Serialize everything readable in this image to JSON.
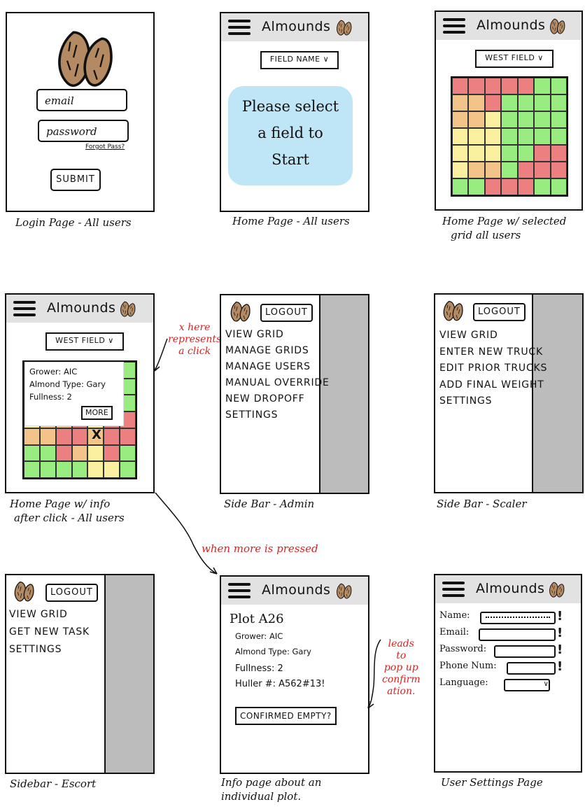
{
  "app_name": "Almounds",
  "colors": {
    "red": "#ec8080",
    "orange": "#f2c48a",
    "yellow": "#fbf0a0",
    "green": "#98ec80",
    "gray": "#bcbcbc",
    "blue": "#bfe6f7",
    "annotation": "#e02020"
  },
  "login": {
    "email_placeholder": "email",
    "password_placeholder": "password",
    "forgot_link": "Forgot Pass?",
    "submit_label": "SUBMIT",
    "caption": "Login Page - All users"
  },
  "home": {
    "field_select": "FIELD NAME",
    "prompt": [
      "Please select",
      "a field to",
      "Start"
    ],
    "caption": "Home Page - All users"
  },
  "home_grid": {
    "field_select": "WEST FIELD",
    "caption": [
      "Home Page w/ selected",
      "grid all users"
    ],
    "grid": [
      [
        "r",
        "r",
        "r",
        "r",
        "r",
        "g",
        "g"
      ],
      [
        "o",
        "o",
        "r",
        "g",
        "g",
        "g",
        "g"
      ],
      [
        "o",
        "o",
        "y",
        "g",
        "g",
        "g",
        "g"
      ],
      [
        "y",
        "y",
        "y",
        "g",
        "g",
        "g",
        "g"
      ],
      [
        "y",
        "y",
        "y",
        "g",
        "g",
        "r",
        "r"
      ],
      [
        "y",
        "o",
        "o",
        "g",
        "r",
        "r",
        "r"
      ],
      [
        "g",
        "g",
        "r",
        "r",
        "r",
        "g",
        "g"
      ]
    ]
  },
  "home_info": {
    "field_select": "WEST FIELD",
    "popup": {
      "grower": "Grower: AIC",
      "almond_type": "Almond Type: Gary",
      "fullness": "Fullness: 2",
      "more_label": "MORE"
    },
    "click_mark": "X",
    "annotation": [
      "x here",
      "represents",
      "a click"
    ],
    "caption": [
      "Home Page w/ info",
      "after click - All users"
    ],
    "grid_bottom": [
      [
        "y",
        "o",
        "o",
        "r",
        "y",
        "r",
        "r"
      ],
      [
        "o",
        "o",
        "r",
        "r",
        "o",
        "r",
        "r"
      ],
      [
        "g",
        "g",
        "r",
        "o",
        "y",
        "r",
        "g"
      ],
      [
        "g",
        "g",
        "g",
        "g",
        "y",
        "y",
        "g"
      ]
    ]
  },
  "sidebar_admin": {
    "logout_label": "LOGOUT",
    "items": [
      "VIEW GRID",
      "MANAGE GRIDS",
      "MANAGE USERS",
      "MANUAL OVERRIDE",
      "NEW DROPOFF",
      "SETTINGS"
    ],
    "caption": "Side Bar - Admin"
  },
  "sidebar_scaler": {
    "logout_label": "LOGOUT",
    "items": [
      "VIEW GRID",
      "ENTER NEW TRUCK",
      "EDIT PRIOR TRUCKS",
      "ADD FINAL WEIGHT",
      "SETTINGS"
    ],
    "caption": "Side Bar - Scaler"
  },
  "sidebar_escort": {
    "logout_label": "LOGOUT",
    "items": [
      "VIEW GRID",
      "GET NEW TASK",
      "SETTINGS"
    ],
    "caption": "Sidebar - Escort"
  },
  "info_page": {
    "title": "Plot A26",
    "grower": "Grower: AIC",
    "almond_type": "Almond Type: Gary",
    "fullness": "Fullness: 2",
    "huller": "Huller #:  A562#13!",
    "confirm_label": "CONFIRMED EMPTY?",
    "caption": [
      "Info page about an",
      "individual plot."
    ],
    "annotation": [
      "leads",
      "to",
      "pop up",
      "confirm",
      "ation."
    ]
  },
  "more_annotation": "when more is pressed",
  "user_settings": {
    "fields": [
      {
        "label": "Name:",
        "control": "text-filled"
      },
      {
        "label": "Email:",
        "control": "text"
      },
      {
        "label": "Password:",
        "control": "text"
      },
      {
        "label": "Phone Num:",
        "control": "text"
      },
      {
        "label": "Language:",
        "control": "select"
      }
    ],
    "required_mark": "!",
    "caption": "User Settings Page"
  }
}
